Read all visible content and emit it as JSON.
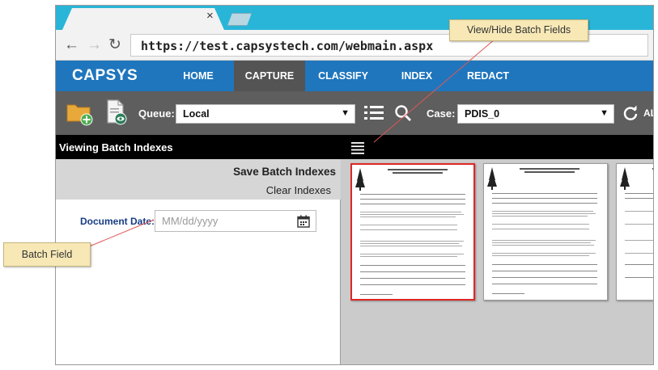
{
  "browser": {
    "tab_close": "×",
    "url": "https://test.capsystech.com/webmain.aspx"
  },
  "app": {
    "brand": "CAPSYS",
    "menu": [
      {
        "label": "HOME"
      },
      {
        "label": "CAPTURE"
      },
      {
        "label": "CLASSIFY"
      },
      {
        "label": "INDEX"
      },
      {
        "label": "REDACT"
      }
    ],
    "active_menu": "CAPTURE"
  },
  "toolbar": {
    "queue_label": "Queue:",
    "queue_value": "Local",
    "case_label": "Case:",
    "case_value": "PDIS_0",
    "clipped_text": "AL"
  },
  "left_panel": {
    "title": "Viewing Batch Indexes",
    "save_label": "Save Batch Indexes",
    "clear_label": "Clear Indexes",
    "field_label": "Document Date:",
    "field_placeholder": "MM/dd/yyyy"
  },
  "callouts": {
    "top": "View/Hide Batch Fields",
    "left": "Batch Field"
  },
  "colors": {
    "tab_strip": "#29b5d8",
    "app_bar": "#1f76bd",
    "active_menu_bg": "#545454",
    "toolbar": "#5e5e5e",
    "selected_border": "#e02525",
    "field_label": "#163d84",
    "callout_bg": "#f7e8b6",
    "callout_line": "#e05555"
  },
  "icons": {
    "add_folder": "folder-add-icon",
    "view_doc": "document-view-icon",
    "list": "list-icon",
    "search": "search-icon",
    "refresh": "refresh-icon",
    "calendar": "calendar-icon"
  }
}
